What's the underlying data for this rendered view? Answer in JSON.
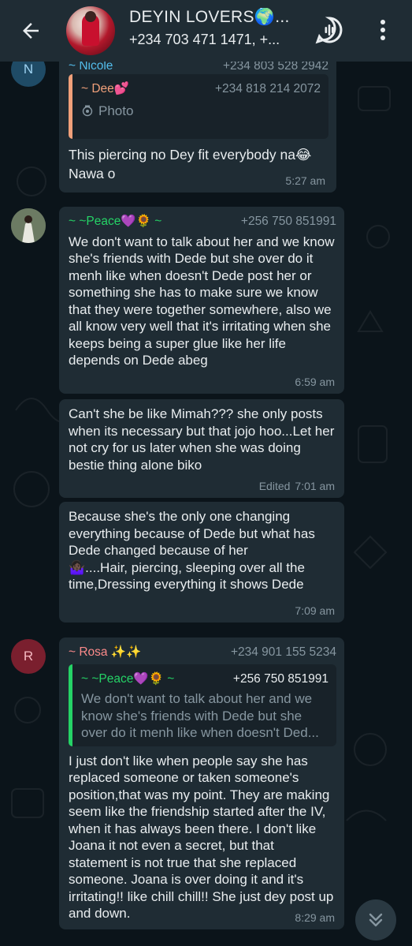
{
  "header": {
    "title": "DEYIN LOVERS🌍...",
    "subtitle": "+234 703 471 1471, +...",
    "back_icon": "arrow-left-icon",
    "call_icon": "group-call-icon",
    "menu_icon": "more-vert-icon"
  },
  "colors": {
    "header_bg": "#1f2c34",
    "chat_bg": "#0b141a",
    "bubble_bg": "#1f2c34",
    "meta_text": "#8696a0",
    "nicole": "#53bdeb",
    "dee": "#f0a07a",
    "peace": "#25d366",
    "rosa": "#fb8a8a"
  },
  "messages": {
    "m1": {
      "avatar_letter": "N",
      "sender": "~ Nicole",
      "sender_phone": "+234 803 528 2942",
      "quote_sender": "~ Dee💕",
      "quote_phone": "+234 818 214 2072",
      "quote_body": "Photo",
      "text": "This piercing no Dey fit everybody na😂 Nawa o",
      "time": "5:27 am"
    },
    "m2": {
      "sender": "~ ~Peace💜🌻 ~",
      "sender_phone": "+256 750 851991",
      "text": "We don't want to talk about her and we know she's friends with Dede but she over do it menh like when doesn't Dede post her or something she has to make sure we know that they were together somewhere, also we all know very well that it's irritating when she keeps being a super glue like her life depends on Dede abeg",
      "time": "6:59 am"
    },
    "m3": {
      "text": "Can't she be like Mimah??? she only posts when its necessary but that jojo hoo...Let her not cry for us later when she was doing bestie thing alone biko",
      "edited": "Edited",
      "time": "7:01 am"
    },
    "m4": {
      "text_a": "Because she's the only one changing everything because of Dede but what has Dede changed because of her",
      "text_b": "🤷🏿‍♀️....Hair, piercing, sleeping over all the time,Dressing everything it shows Dede",
      "time": "7:09 am"
    },
    "m5": {
      "avatar_letter": "R",
      "sender": "~ Rosa ✨✨",
      "sender_phone": "+234 901 155 5234",
      "quote_sender": "~ ~Peace💜🌻 ~",
      "quote_phone": "+256 750 851991",
      "quote_body": "We don't want to talk about her and we know she's friends with Dede but she over do it menh like when doesn't Ded...",
      "text": "I just don't like when people say she has replaced someone or taken someone's position,that was my point. They are making seem like the friendship started after the IV, when it has always been there. I don't like Joana it not even a secret, but that statement is not true that she replaced someone. Joana is over doing it and it's irritating!! like chill chill!! She just dey post up and down.",
      "time": "8:29 am"
    }
  },
  "scroll_button_icon": "double-chevron-down-icon"
}
